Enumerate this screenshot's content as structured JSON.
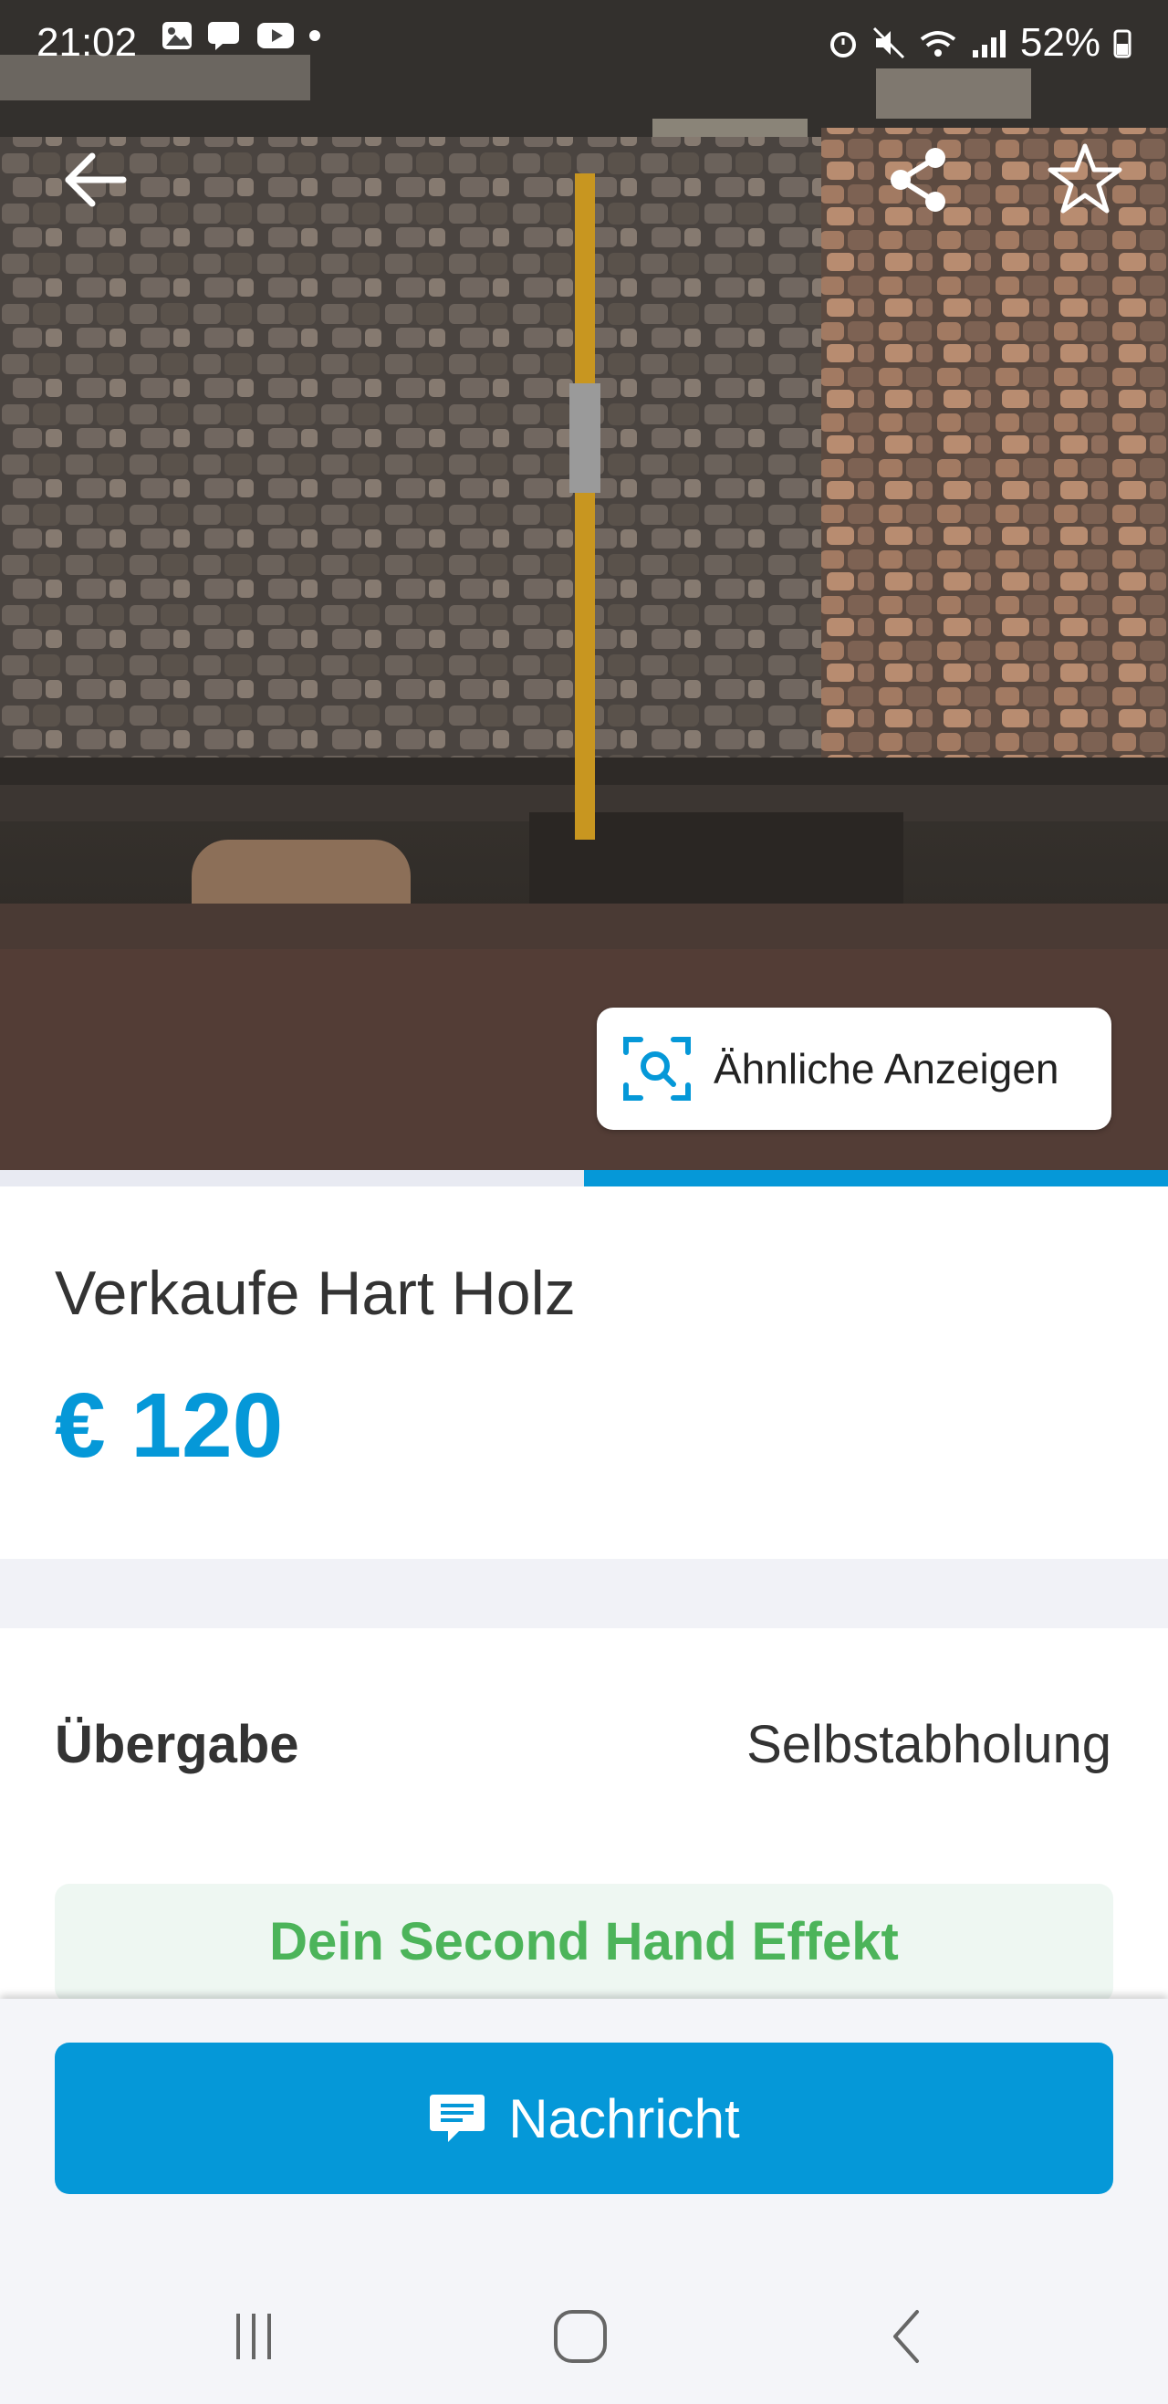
{
  "status_bar": {
    "time": "21:02",
    "battery": "52%"
  },
  "listing": {
    "title": "Verkaufe Hart Holz",
    "price": "€ 120"
  },
  "image_overlay": {
    "similar_label": "Ähnliche Anzeigen"
  },
  "gallery": {
    "progress": 0.5
  },
  "details": {
    "handover_label": "Übergabe",
    "handover_value": "Selbstabholung"
  },
  "effect": {
    "label": "Dein Second Hand Effekt"
  },
  "actions": {
    "message_label": "Nachricht"
  },
  "colors": {
    "accent": "#0598d8",
    "effect_green": "#4cb45a",
    "effect_bg": "#eef7f2"
  },
  "icons": {
    "back": "arrow-left-icon",
    "share": "share-icon",
    "favorite": "star-outline-icon",
    "similar": "image-search-icon",
    "message": "chat-bubble-icon",
    "nav_recents": "recents-icon",
    "nav_home": "home-icon",
    "nav_back": "back-chevron-icon"
  }
}
